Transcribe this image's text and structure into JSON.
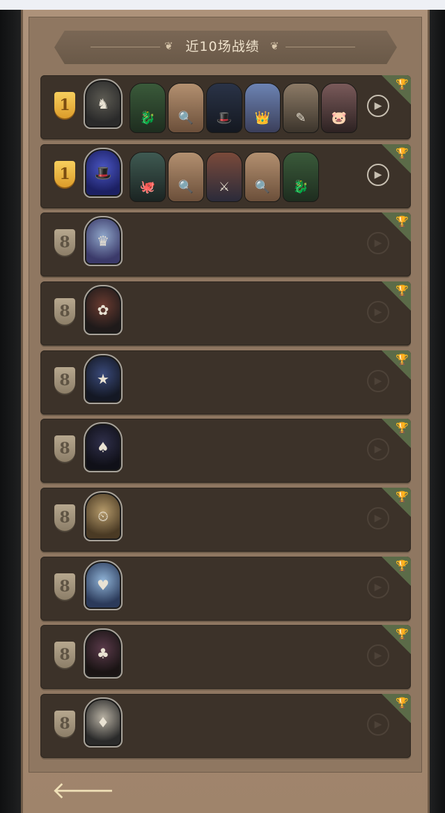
{
  "title": "近10场战绩",
  "records": [
    {
      "rank": "1",
      "rank_style": "gold",
      "hero": {
        "icon": "♞",
        "c1": "#5c5a52",
        "c2": "#2a2a2a"
      },
      "team": [
        {
          "icon": "🐉",
          "m1": "#3a5a3a",
          "m2": "#1e2d1f"
        },
        {
          "icon": "🔍",
          "m1": "#b39070",
          "m2": "#6b4f3a"
        },
        {
          "icon": "🎩",
          "m1": "#2a3347",
          "m2": "#141820"
        },
        {
          "icon": "👑",
          "m1": "#6c83b3",
          "m2": "#3b3f5a"
        },
        {
          "icon": "✎",
          "m1": "#8c7a66",
          "m2": "#3c352c"
        },
        {
          "icon": "🐷",
          "m1": "#7a5a5a",
          "m2": "#2d2222"
        }
      ],
      "replay_active": true
    },
    {
      "rank": "1",
      "rank_style": "gold",
      "hero": {
        "icon": "🎩",
        "c1": "#4a56c4",
        "c2": "#1c2063"
      },
      "team": [
        {
          "icon": "🐙",
          "m1": "#3f5a52",
          "m2": "#1b2422"
        },
        {
          "icon": "🔍",
          "m1": "#b39070",
          "m2": "#6b4f3a"
        },
        {
          "icon": "⚔",
          "m1": "#7a4a3a",
          "m2": "#2b2b3a"
        },
        {
          "icon": "🔍",
          "m1": "#b39070",
          "m2": "#6b4f3a"
        },
        {
          "icon": "🐉",
          "m1": "#3a5a3a",
          "m2": "#1e2d1f"
        }
      ],
      "replay_active": true
    },
    {
      "rank": "8",
      "rank_style": "gray",
      "hero": {
        "icon": "♛",
        "c1": "#8fa6c9",
        "c2": "#3b3a6a"
      },
      "team": [],
      "replay_active": false
    },
    {
      "rank": "8",
      "rank_style": "gray",
      "hero": {
        "icon": "✿",
        "c1": "#6a3b30",
        "c2": "#1f1a1a"
      },
      "team": [],
      "replay_active": false
    },
    {
      "rank": "8",
      "rank_style": "gray",
      "hero": {
        "icon": "★",
        "c1": "#3a4a7a",
        "c2": "#141824"
      },
      "team": [],
      "replay_active": false
    },
    {
      "rank": "8",
      "rank_style": "gray",
      "hero": {
        "icon": "♠",
        "c1": "#2f2f4a",
        "c2": "#101018"
      },
      "team": [],
      "replay_active": false
    },
    {
      "rank": "8",
      "rank_style": "gray",
      "hero": {
        "icon": "⏲",
        "c1": "#b59a6a",
        "c2": "#4a3a24"
      },
      "team": [],
      "replay_active": false
    },
    {
      "rank": "8",
      "rank_style": "gray",
      "hero": {
        "icon": "♥",
        "c1": "#8fb3d6",
        "c2": "#2b3a5a"
      },
      "team": [],
      "replay_active": false
    },
    {
      "rank": "8",
      "rank_style": "gray",
      "hero": {
        "icon": "♣",
        "c1": "#5a3a4a",
        "c2": "#1a1414"
      },
      "team": [],
      "replay_active": false
    },
    {
      "rank": "8",
      "rank_style": "gray",
      "hero": {
        "icon": "♦",
        "c1": "#b7b0a2",
        "c2": "#2a2a2a"
      },
      "team": [],
      "replay_active": false
    }
  ],
  "icons": {
    "corner": "trophy-cups-icon",
    "play": "play-circle-icon",
    "back": "back-arrow-icon"
  },
  "glyphs": {
    "play": "▶",
    "corner": "🏆",
    "back": "🡐"
  }
}
